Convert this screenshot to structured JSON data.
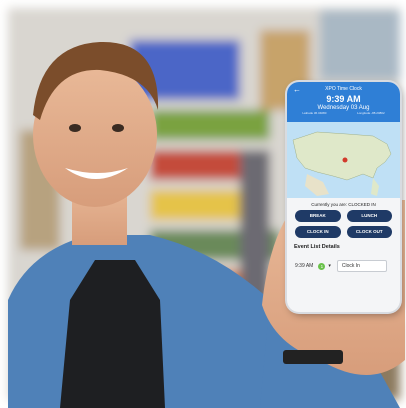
{
  "app": {
    "title": "XPO Time Clock",
    "time": "9:39 AM",
    "date": "Wednesday 03 Aug",
    "coord_left": "Latitude 36.34080",
    "coord_right": "Longitude -88.20802"
  },
  "status": "Currently you are: CLOCKED IN",
  "buttons": {
    "break": "BREAK",
    "lunch": "LUNCH",
    "clock_in": "CLOCK IN",
    "clock_out": "CLOCK OUT"
  },
  "events": {
    "title": "Event List Details",
    "items": [
      {
        "time": "9:39 AM",
        "badge": "1",
        "type": "Clock In"
      }
    ]
  },
  "colors": {
    "app_bar": "#2f7fd6",
    "button": "#1f3a66",
    "shirt": "#4f81b8",
    "apron": "#1e1f22"
  }
}
